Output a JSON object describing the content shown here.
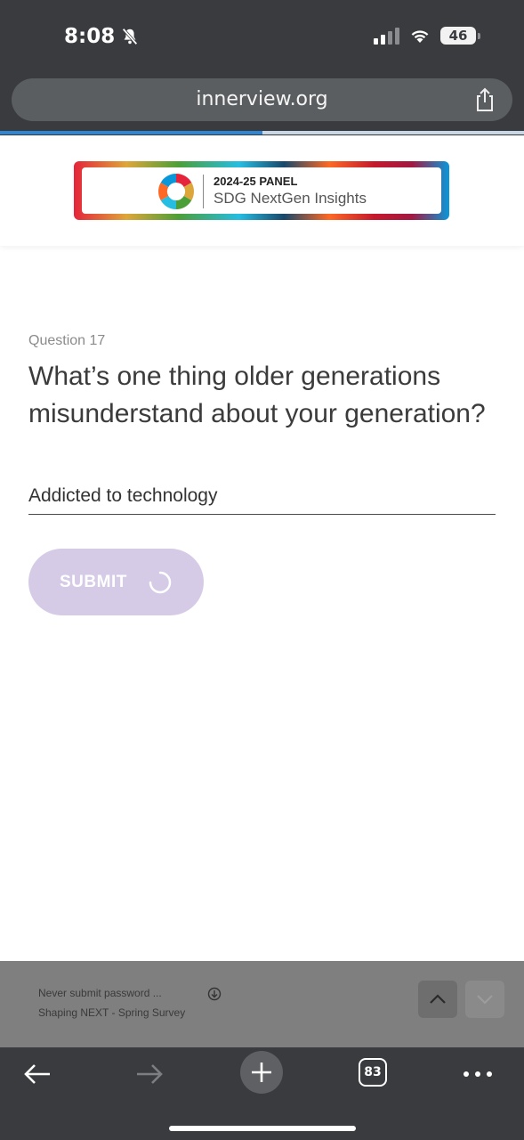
{
  "status_bar": {
    "time": "8:08",
    "battery": "46",
    "icons": [
      "bell-slash-icon",
      "cellular-signal-icon",
      "wifi-icon",
      "battery-icon"
    ]
  },
  "browser": {
    "url": "innerview.org",
    "load_progress": 0.5,
    "tab_count": "83",
    "icons": [
      "share-icon",
      "back-arrow-icon",
      "forward-arrow-icon",
      "plus-icon",
      "tabs-icon",
      "more-icon"
    ]
  },
  "header": {
    "logo_line1_year": "2024-25 ",
    "logo_line1_bold": "PANEL",
    "logo_line2": "SDG NextGen Insights"
  },
  "question": {
    "number_label": "Question 17",
    "text": "What’s one thing older generations misunderstand about your generation?",
    "answer_value": "Addicted to technology",
    "submit_label": "SUBMIT"
  },
  "assist_bar": {
    "line1": "Never submit password    ...",
    "line2": "Shaping NEXT - Spring Survey"
  },
  "colors": {
    "chrome": "#393b3e",
    "submit_bg": "#d6cbe6",
    "progress": "#2f86d6"
  }
}
